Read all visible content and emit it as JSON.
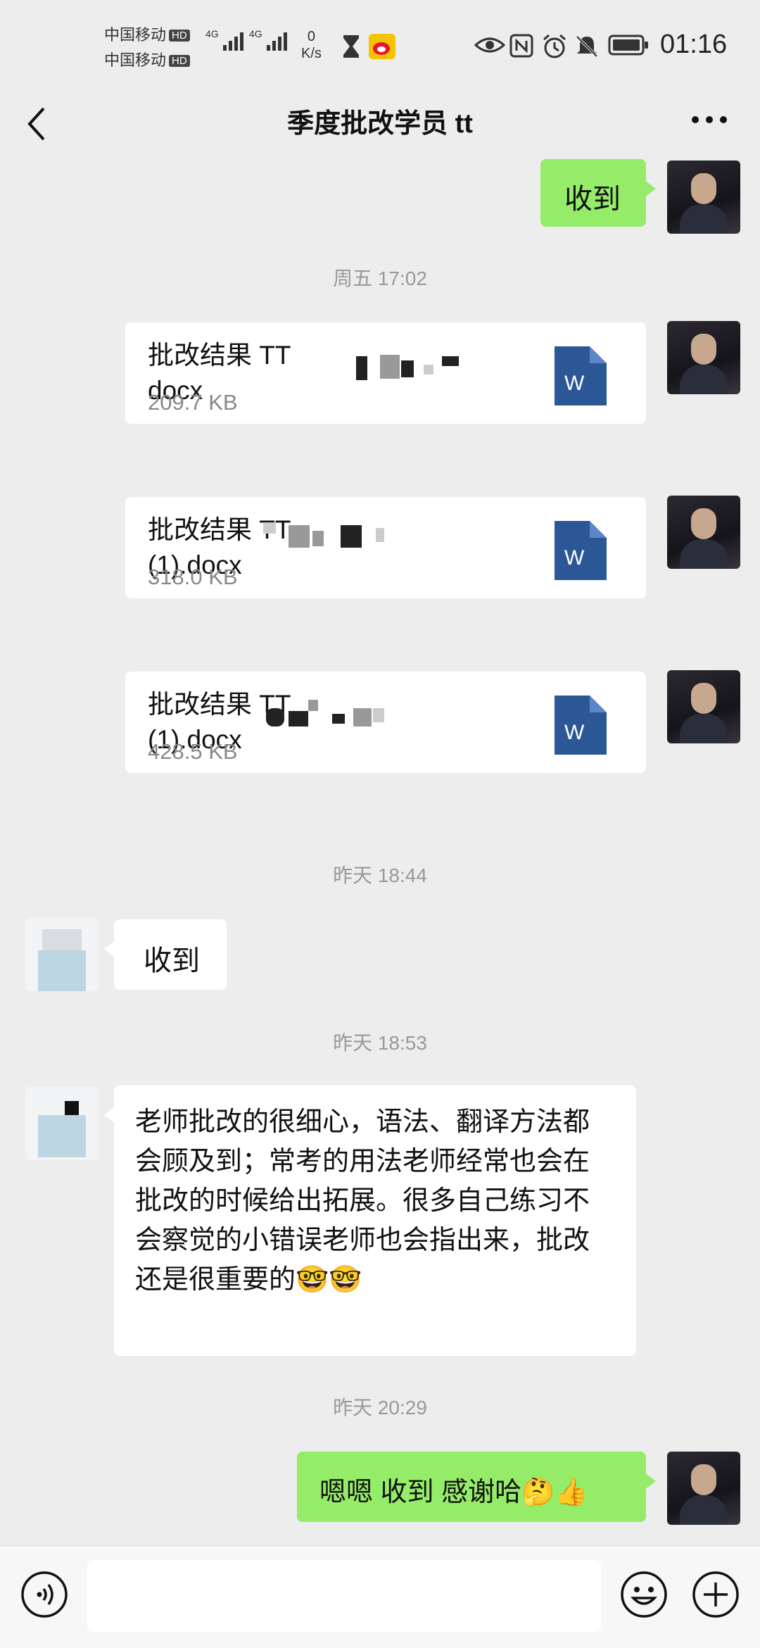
{
  "status_bar": {
    "carrier1": "中国移动",
    "carrier2": "中国移动",
    "hd_badge": "HD",
    "network": "4G",
    "net_speed_value": "0",
    "net_speed_unit": "K/s",
    "time": "01:16"
  },
  "header": {
    "title": "季度批改学员 tt"
  },
  "messages": {
    "m1": {
      "sender": "me",
      "text": "收到"
    },
    "ts1": "周五 17:02",
    "file1": {
      "name_line1": "批改结果 TT",
      "name_line2": "docx",
      "size": "209.7 KB",
      "icon_letter": "W"
    },
    "file2": {
      "name_line1": "批改结果 TT",
      "name_line2": "(1).docx",
      "size": "318.0 KB",
      "icon_letter": "W"
    },
    "file3": {
      "name_line1": "批改结果 TT",
      "name_line2": "(1).docx",
      "size": "428.5 KB",
      "icon_letter": "W"
    },
    "ts2": "昨天 18:44",
    "m2": {
      "sender": "other",
      "text": "收到"
    },
    "ts3": "昨天 18:53",
    "m3": {
      "sender": "other",
      "text": "老师批改的很细心，语法、翻译方法都会顾及到；常考的用法老师经常也会在批改的时候给出拓展。很多自己练习不会察觉的小错误老师也会指出来，批改还是很重要的🤓🤓"
    },
    "ts4": "昨天 20:29",
    "m4": {
      "sender": "me",
      "text": "嗯嗯 收到 感谢哈🤔👍"
    }
  },
  "colors": {
    "background": "#ededed",
    "my_bubble": "#95ec69",
    "other_bubble": "#ffffff",
    "word_blue": "#2b5797"
  }
}
